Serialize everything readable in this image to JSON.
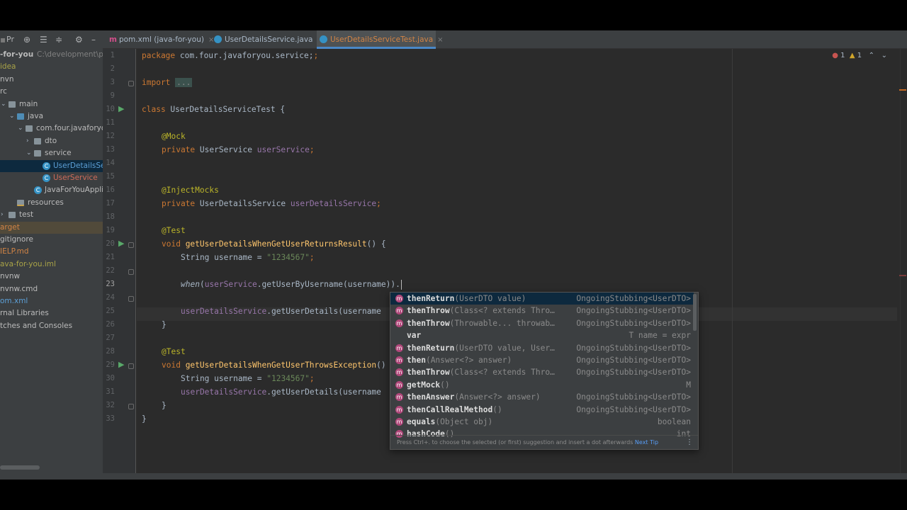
{
  "project_panel": {
    "toolbar_label": "Pr",
    "tree": [
      {
        "label": "-for-you",
        "hint": "C:\\development\\pe",
        "color": "bold",
        "level": 0,
        "icon": "none"
      },
      {
        "label": "idea",
        "color": "olive",
        "level": 0,
        "icon": "none"
      },
      {
        "label": "nvn",
        "color": "plain",
        "level": 0,
        "icon": "none"
      },
      {
        "label": "rc",
        "color": "plain",
        "level": 0,
        "icon": "none"
      },
      {
        "label": "main",
        "color": "plain",
        "level": 1,
        "icon": "folder"
      },
      {
        "label": "java",
        "color": "plain",
        "level": 2,
        "icon": "src"
      },
      {
        "label": "com.four.javaforyou",
        "color": "plain",
        "level": 3,
        "icon": "folder"
      },
      {
        "label": "dto",
        "color": "plain",
        "level": 4,
        "icon": "folder"
      },
      {
        "label": "service",
        "color": "plain",
        "level": 4,
        "icon": "folder"
      },
      {
        "label": "UserDetailsServ",
        "color": "blue",
        "level": 5,
        "icon": "class",
        "selected": true
      },
      {
        "label": "UserService",
        "color": "red",
        "level": 5,
        "icon": "class"
      },
      {
        "label": "JavaForYouApplica",
        "color": "plain",
        "level": 4,
        "icon": "class"
      },
      {
        "label": "resources",
        "color": "plain",
        "level": 2,
        "icon": "res"
      },
      {
        "label": "test",
        "color": "plain",
        "level": 1,
        "icon": "folder"
      },
      {
        "label": "arget",
        "color": "orange",
        "level": 0,
        "icon": "none",
        "excluded": true
      },
      {
        "label": "gitignore",
        "color": "plain",
        "level": 0,
        "icon": "none"
      },
      {
        "label": "IELP.md",
        "color": "orange",
        "level": 0,
        "icon": "none"
      },
      {
        "label": "ava-for-you.iml",
        "color": "olive",
        "level": 0,
        "icon": "none"
      },
      {
        "label": "nvnw",
        "color": "plain",
        "level": 0,
        "icon": "none"
      },
      {
        "label": "nvnw.cmd",
        "color": "plain",
        "level": 0,
        "icon": "none"
      },
      {
        "label": "om.xml",
        "color": "blue",
        "level": 0,
        "icon": "none"
      },
      {
        "label": "rnal Libraries",
        "color": "plain",
        "level": 0,
        "icon": "none"
      },
      {
        "label": "tches and Consoles",
        "color": "plain",
        "level": 0,
        "icon": "none"
      }
    ]
  },
  "tabs": [
    {
      "label": "pom.xml (java-for-you)",
      "kind": "maven"
    },
    {
      "label": "UserDetailsService.java",
      "kind": "class"
    },
    {
      "label": "UserDetailsServiceTest.java",
      "kind": "class",
      "active": true
    }
  ],
  "inspections": {
    "errors": "1",
    "warnings": "1"
  },
  "editor": {
    "line_numbers": [
      "1",
      "2",
      "3",
      "9",
      "10",
      "11",
      "12",
      "13",
      "14",
      "15",
      "16",
      "17",
      "18",
      "19",
      "20",
      "21",
      "22",
      "23",
      "24",
      "25",
      "26",
      "27",
      "28",
      "29",
      "30",
      "31",
      "32",
      "33"
    ],
    "current_line": "23",
    "lines": {
      "l1_kw": "package",
      "l1_rest": " com.four.javaforyou.service;",
      "l3_kw": "import",
      "l3_fold": "...",
      "l10_kw": "class",
      "l10_rest": " UserDetailsServiceTest {",
      "l12": "@Mock",
      "l13_kw": "private",
      "l13_type": " UserService ",
      "l13_field": "userService",
      "l13_end": ";",
      "l16": "@InjectMocks",
      "l17_kw": "private",
      "l17_type": " UserDetailsService ",
      "l17_field": "userDetailsService",
      "l17_end": ";",
      "l19": "@Test",
      "l20_kw": "void",
      "l20_fn": " getUserDetailsWhenGetUserReturnsResult",
      "l20_end": "() {",
      "l21_type": "String username = ",
      "l21_str": "\"1234567\"",
      "l21_end": ";",
      "l23_when": "when",
      "l23_a": "(",
      "l23_field": "userService",
      "l23_b": ".getUserByUsername(username)).",
      "l25_field": "userDetailsService",
      "l25_rest": ".getUserDetails(username",
      "l26": "}",
      "l28": "@Test",
      "l29_kw": "void",
      "l29_fn": " getUserDetailsWhenGetUserThrowsException",
      "l29_end": "()",
      "l30_type": "String username = ",
      "l30_str": "\"1234567\"",
      "l30_end": ";",
      "l31_field": "userDetailsService",
      "l31_rest": ".getUserDetails(username",
      "l32": "}",
      "l33": "}"
    }
  },
  "completion": {
    "items": [
      {
        "icon": "m",
        "name": "thenReturn",
        "params": "(UserDTO value)",
        "type": "OngoingStubbing<UserDTO>",
        "selected": true
      },
      {
        "icon": "m",
        "name": "thenThrow",
        "params": "(Class<? extends Thro…",
        "type": "OngoingStubbing<UserDTO>"
      },
      {
        "icon": "m",
        "name": "thenThrow",
        "params": "(Throwable... throwab…",
        "type": "OngoingStubbing<UserDTO>"
      },
      {
        "icon": "",
        "name": "var",
        "params": "",
        "type": "T name = expr"
      },
      {
        "icon": "m",
        "name": "thenReturn",
        "params": "(UserDTO value, User…",
        "type": "OngoingStubbing<UserDTO>"
      },
      {
        "icon": "m",
        "name": "then",
        "params": "(Answer<?> answer)",
        "type": "OngoingStubbing<UserDTO>"
      },
      {
        "icon": "m",
        "name": "thenThrow",
        "params": "(Class<? extends Thro…",
        "type": "OngoingStubbing<UserDTO>"
      },
      {
        "icon": "m",
        "name": "getMock",
        "params": "()",
        "type": "M"
      },
      {
        "icon": "m",
        "name": "thenAnswer",
        "params": "(Answer<?> answer)",
        "type": "OngoingStubbing<UserDTO>"
      },
      {
        "icon": "m",
        "name": "thenCallRealMethod",
        "params": "()",
        "type": "OngoingStubbing<UserDTO>"
      },
      {
        "icon": "m",
        "name": "equals",
        "params": "(Object obj)",
        "type": "boolean"
      },
      {
        "icon": "m",
        "name": "hashCode",
        "params": "()",
        "type": "int"
      }
    ],
    "hint_text": "Press Ctrl+. to choose the selected (or first) suggestion and insert a dot afterwards",
    "hint_link": "Next Tip"
  },
  "colors": {
    "accent": "#4a88c7",
    "selection": "#0d293e",
    "editor_bg": "#2b2b2b"
  }
}
